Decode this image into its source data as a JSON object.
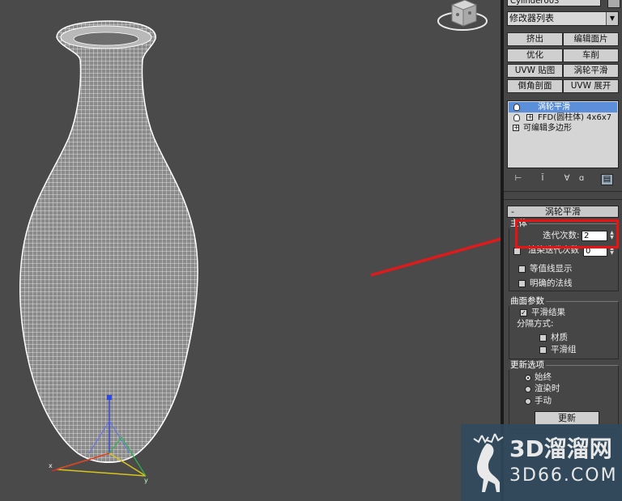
{
  "object_name": "Cylinder003",
  "modifier_list_label": "修改器列表",
  "modifier_buttons": [
    "挤出",
    "编辑面片",
    "优化",
    "车削",
    "UVW 贴图",
    "涡轮平滑",
    "倒角剖面",
    "UVW 展开"
  ],
  "stack": {
    "items": [
      {
        "label": "涡轮平滑",
        "selected": true
      },
      {
        "label": "FFD(圆柱体) 4x6x7",
        "selected": false
      },
      {
        "label": "可编辑多边形",
        "selected": false
      }
    ]
  },
  "rollout": {
    "title": "涡轮平滑",
    "collapse_symbol": "-",
    "main_group": {
      "title": "主体",
      "iterations_label": "迭代次数:",
      "iterations_value": "2",
      "render_iters_label": "渲染迭代次数",
      "render_iters_value": "0",
      "isoline_label": "等值线显示",
      "explicit_normals_label": "明确的法线"
    },
    "surface_group": {
      "title": "曲面参数",
      "smooth_result_label": "平滑结果",
      "separate_by_label": "分隔方式:",
      "materials_label": "材质",
      "smoothing_groups_label": "平滑组"
    },
    "update_group": {
      "title": "更新选项",
      "always_label": "始终",
      "when_rendering_label": "渲染时",
      "manually_label": "手动",
      "update_button": "更新"
    }
  },
  "watermark": {
    "main": "3D溜溜网",
    "sub": "3D66.COM"
  },
  "colors": {
    "viewport_bg": "#4a4a4a",
    "panel_bg": "#464646",
    "selection": "#5b8fd9",
    "highlight": "#ee1111",
    "watermark_bg": "#2f4a5e"
  }
}
